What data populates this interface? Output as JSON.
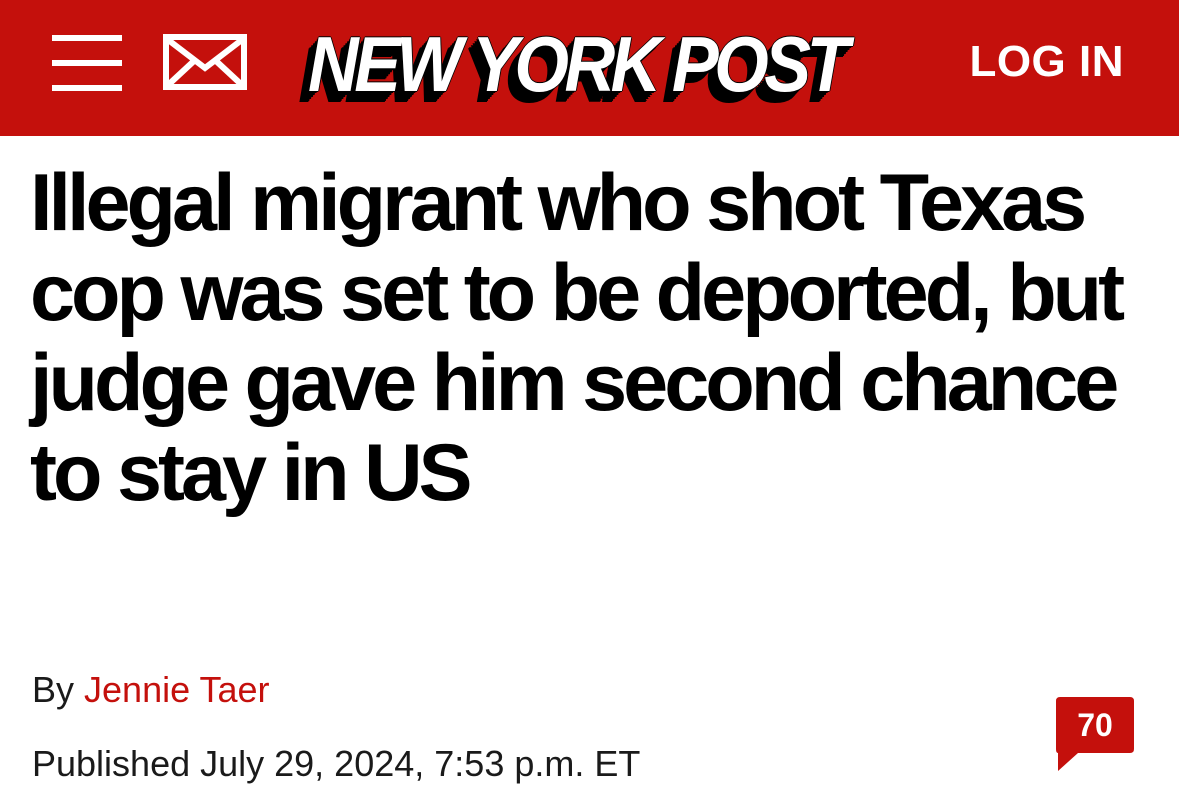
{
  "header": {
    "menu_icon": "hamburger-menu-icon",
    "mail_icon": "envelope-icon",
    "logo_text": "NEW YORK POST",
    "login_label": "LOG IN",
    "brand_color": "#c4100c"
  },
  "article": {
    "headline": "Illegal migrant who shot Texas cop was set to be deported, but judge gave him second chance to stay in US",
    "byline_prefix": "By",
    "author": "Jennie Taer",
    "published": "Published July 29, 2024, 7:53 p.m. ET",
    "comment_count": "70",
    "comment_icon": "speech-bubble-icon"
  }
}
